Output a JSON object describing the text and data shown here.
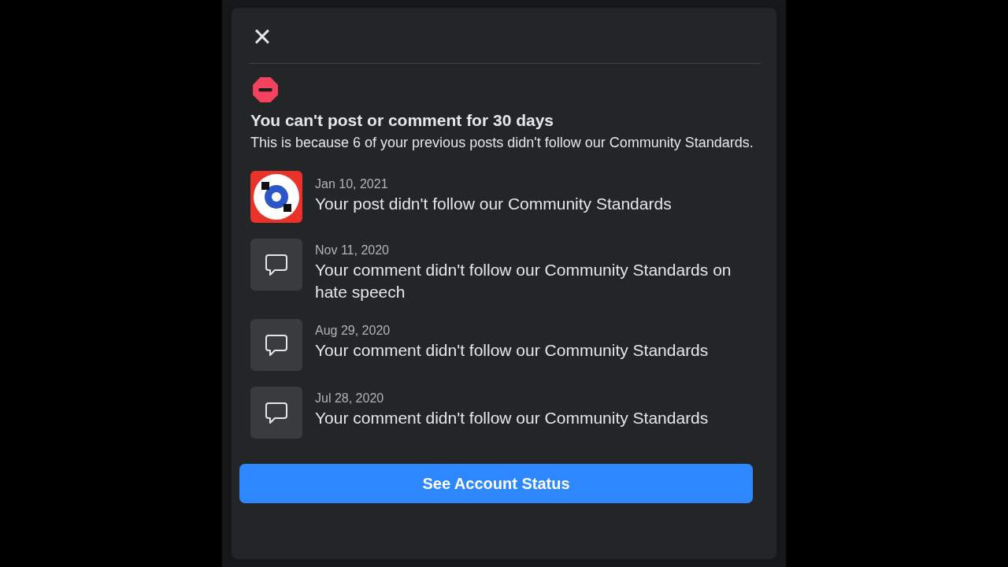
{
  "dialog": {
    "close": "×",
    "title": "You can't post or comment for 30 days",
    "message": "This is because 6 of your previous posts didn't follow our Community Standards.",
    "items": [
      {
        "kind": "post",
        "date": "Jan 10, 2021",
        "text": "Your post didn't follow our Community Standards"
      },
      {
        "kind": "comment",
        "date": "Nov 11, 2020",
        "text": "Your comment didn't follow our Community Standards on hate speech"
      },
      {
        "kind": "comment",
        "date": "Aug 29, 2020",
        "text": "Your comment didn't follow our Community Standards"
      },
      {
        "kind": "comment",
        "date": "Jul 28, 2020",
        "text": "Your comment didn't follow our Community Standards"
      }
    ],
    "button": "See Account Status"
  }
}
